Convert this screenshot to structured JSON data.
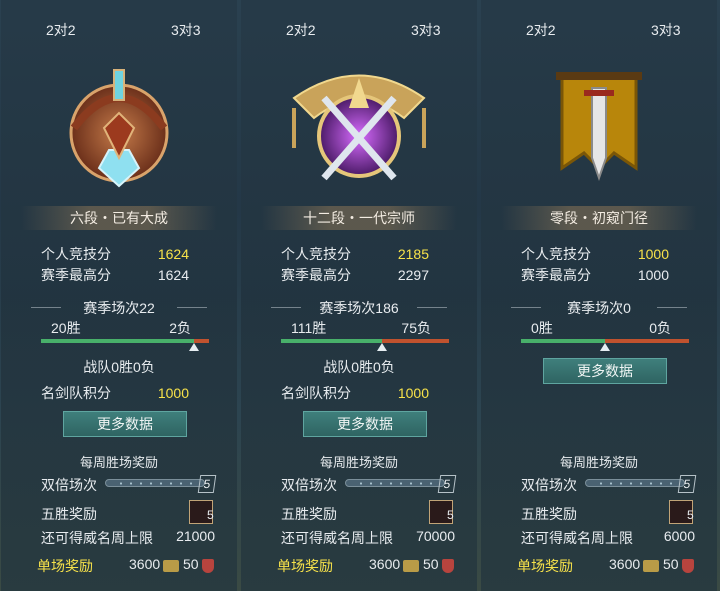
{
  "panels": [
    {
      "tab_left": "2对2",
      "tab_right": "3对3",
      "rank_title": "六段・已有大成",
      "arena_score_label": "个人竞技分",
      "arena_score": "1624",
      "season_high_label": "赛季最高分",
      "season_high": "1624",
      "season_matches": "赛季场次22",
      "wins": "20胜",
      "losses": "2负",
      "win_ratio": 0.91,
      "team_record": "战队0胜0负",
      "team_score_label": "名剑队积分",
      "team_score": "1000",
      "more_button": "更多数据",
      "weekly_title": "每周胜场奖励",
      "double_label": "双倍场次",
      "double_count": "5",
      "five_wins_label": "五胜奖励",
      "five_count": "5",
      "cap_label": "还可得威名周上限",
      "cap_value": "21000",
      "single_label": "单场奖励",
      "single_coin": "3600",
      "single_token": "50"
    },
    {
      "tab_left": "2对2",
      "tab_right": "3对3",
      "rank_title": "十二段・一代宗师",
      "arena_score_label": "个人竞技分",
      "arena_score": "2185",
      "season_high_label": "赛季最高分",
      "season_high": "2297",
      "season_matches": "赛季场次186",
      "wins": "111胜",
      "losses": "75负",
      "win_ratio": 0.6,
      "team_record": "战队0胜0负",
      "team_score_label": "名剑队积分",
      "team_score": "1000",
      "more_button": "更多数据",
      "weekly_title": "每周胜场奖励",
      "double_label": "双倍场次",
      "double_count": "5",
      "five_wins_label": "五胜奖励",
      "five_count": "5",
      "cap_label": "还可得威名周上限",
      "cap_value": "70000",
      "single_label": "单场奖励",
      "single_coin": "3600",
      "single_token": "50"
    },
    {
      "tab_left": "2对2",
      "tab_right": "3对3",
      "rank_title": "零段・初窥门径",
      "arena_score_label": "个人竞技分",
      "arena_score": "1000",
      "season_high_label": "赛季最高分",
      "season_high": "1000",
      "season_matches": "赛季场次0",
      "wins": "0胜",
      "losses": "0负",
      "win_ratio": 0.5,
      "more_button": "更多数据",
      "weekly_title": "每周胜场奖励",
      "double_label": "双倍场次",
      "double_count": "5",
      "five_wins_label": "五胜奖励",
      "five_count": "5",
      "cap_label": "还可得威名周上限",
      "cap_value": "6000",
      "single_label": "单场奖励",
      "single_coin": "3600",
      "single_token": "50"
    }
  ],
  "colors": {
    "highlight": "#f7e24a",
    "win": "#48b06a",
    "loss": "#c0522e",
    "button": "#3f7f7c"
  }
}
